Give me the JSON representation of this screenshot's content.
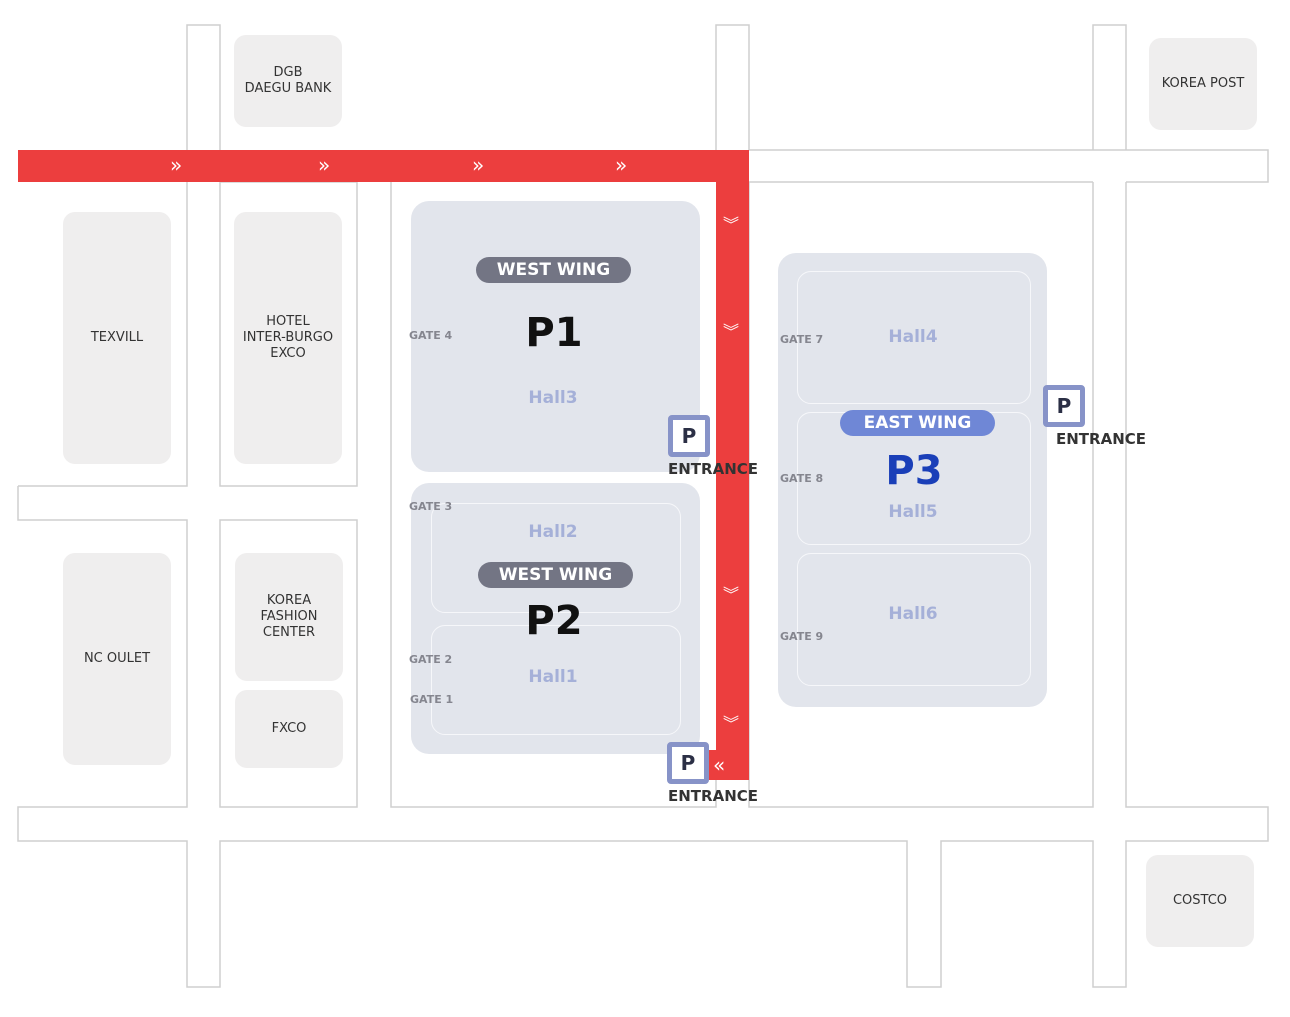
{
  "colors": {
    "route": "#ec3e3e",
    "west_wing": "#737584",
    "east_wing": "#6f87d6",
    "p3": "#1a3fb8",
    "hall_label": "#a5b0d8",
    "parking": "#8793c8",
    "building": "#efeeee",
    "hall_bg": "#e2e5ec"
  },
  "buildings": {
    "dgb": "DGB\nDAEGU BANK",
    "korea_post": "KOREA POST",
    "texvill": "TEXVILL",
    "hotel": "HOTEL\nINTER-BURGO\nEXCO",
    "nc_outlet": "NC OULET",
    "korea_fashion": "KOREA\nFASHION\nCENTER",
    "fxco": "FXCO",
    "costco": "COSTCO"
  },
  "p1": {
    "wing": "WEST WING",
    "name": "P1",
    "hall": "Hall3",
    "gate": "GATE 4"
  },
  "p2": {
    "wing": "WEST WING",
    "name": "P2",
    "halls": [
      "Hall2",
      "Hall1"
    ],
    "gates": [
      "GATE 3",
      "GATE 2",
      "GATE 1"
    ]
  },
  "p3": {
    "wing": "EAST WING",
    "name": "P3",
    "halls": [
      "Hall4",
      "Hall5",
      "Hall6"
    ],
    "gates": [
      "GATE 7",
      "GATE 8",
      "GATE 9"
    ]
  },
  "parking": {
    "icon": "P",
    "label": "ENTRANCE"
  },
  "route": {
    "arrow_right": "»",
    "arrow_down": "︾",
    "arrow_left": "«"
  }
}
